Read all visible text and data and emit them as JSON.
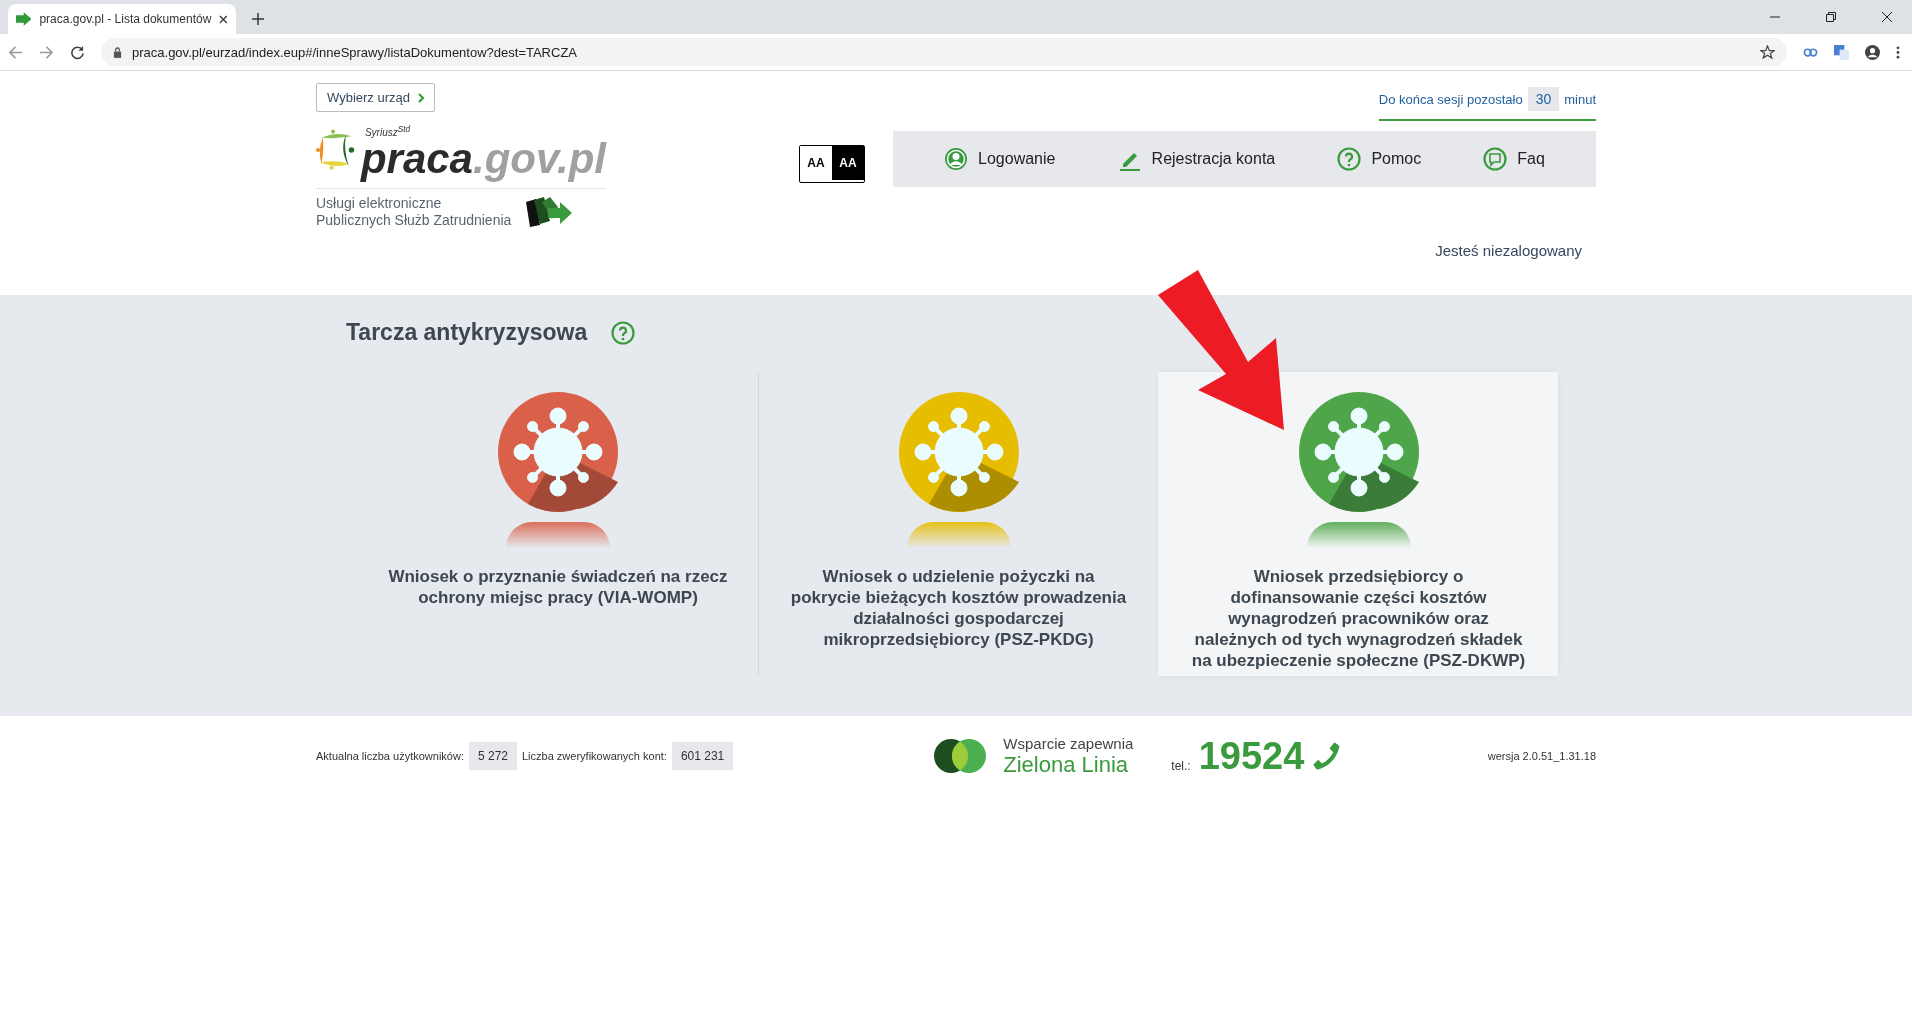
{
  "browser": {
    "tab_title": "praca.gov.pl - Lista dokumentów",
    "url": "praca.gov.pl/eurzad/index.eup#/inneSprawy/listaDokumentow?dest=TARCZA"
  },
  "header": {
    "office_button": "Wybierz urząd",
    "logo_super": "Syriusz",
    "logo_super_raised": "Std",
    "logo_main": "praca",
    "logo_domain": ".gov.pl",
    "subtitle_1": "Usługi elektroniczne",
    "subtitle_2": "Publicznych Służb Zatrudnienia",
    "contrast": [
      {
        "label": "AA",
        "selected": false
      },
      {
        "label": "AA",
        "selected": true
      }
    ],
    "session": {
      "prefix": "Do końca sesji pozostało",
      "minutes": "30",
      "suffix": "minut"
    },
    "nav": [
      {
        "label": "Logowanie",
        "kind": "user"
      },
      {
        "label": "Rejestracja konta",
        "kind": "pencil"
      },
      {
        "label": "Pomoc",
        "kind": "help"
      },
      {
        "label": "Faq",
        "kind": "chat"
      }
    ],
    "login_status": "Jesteś niezalogowany"
  },
  "section": {
    "title": "Tarcza antykryzysowa",
    "cards": [
      {
        "label": "Wniosek o przyznanie świadczeń na rzecz ochrony miejsc pracy (VIA-WOMP)",
        "color": "#d9614a",
        "selected": false
      },
      {
        "label": "Wniosek o udzielenie pożyczki na pokrycie bieżących kosztów prowadzenia działalności gospodarczej mikroprzedsiębiorcy (PSZ-PKDG)",
        "color": "#e6bd00",
        "selected": false
      },
      {
        "label": "Wniosek przedsiębiorcy o dofinansowanie części kosztów wynagrodzeń pracowników oraz należnych od tych wynagrodzeń składek na ubezpieczenie społeczne (PSZ-DKWP)",
        "color": "#4fa64a",
        "selected": true
      }
    ]
  },
  "footer": {
    "users_label": "Aktualna liczba użytkowników:",
    "users": "5 272",
    "accounts_label": "Liczba zweryfikowanych kont:",
    "accounts": "601 231",
    "support_1": "Wsparcie zapewnia",
    "support_2": "Zielona Linia",
    "tel_label": "tel.:",
    "tel": "19524",
    "version": "wersja 2.0.51_1.31.18"
  }
}
